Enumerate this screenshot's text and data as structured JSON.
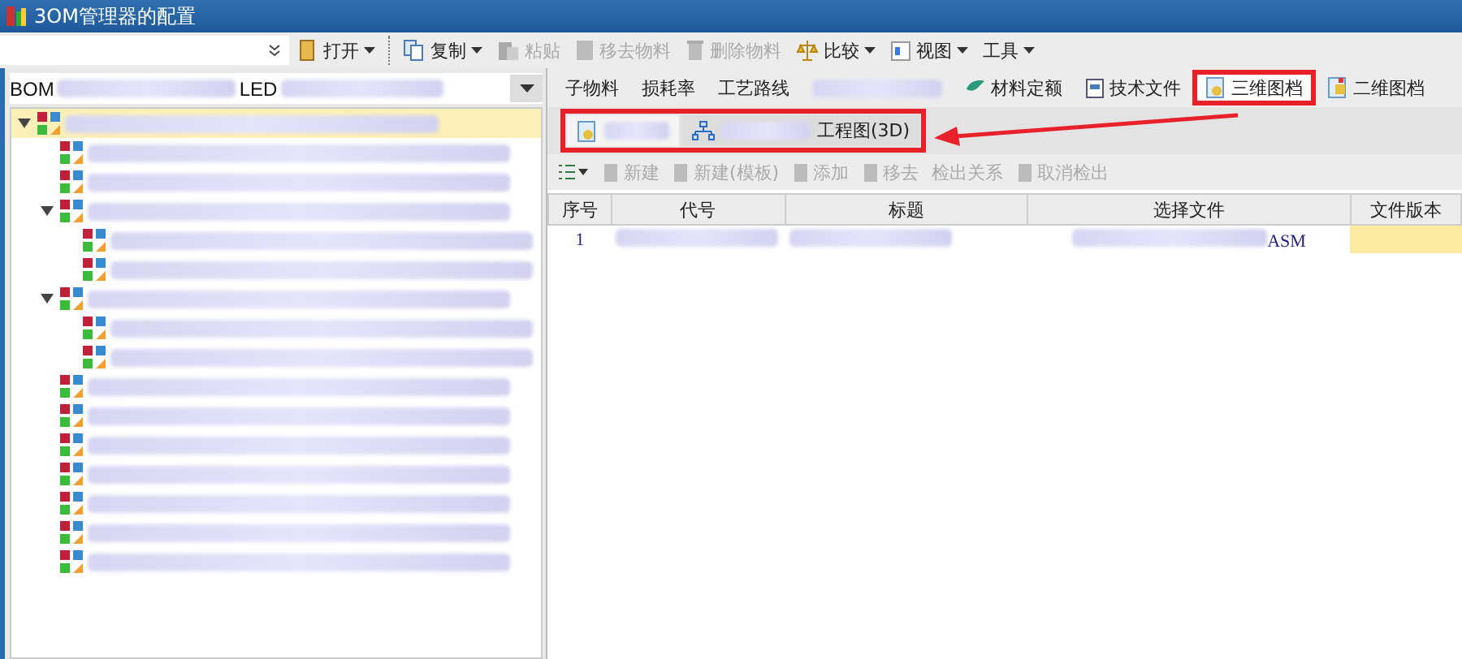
{
  "window": {
    "title": "3OM管理器的配置"
  },
  "toolbar": {
    "items": [
      {
        "label": "打开",
        "disabled": false,
        "dropdown": true
      },
      {
        "label": "复制",
        "disabled": false,
        "dropdown": true
      },
      {
        "label": "粘贴",
        "disabled": true,
        "dropdown": false
      },
      {
        "label": "移去物料",
        "disabled": true,
        "dropdown": false
      },
      {
        "label": "删除物料",
        "disabled": true,
        "dropdown": false
      },
      {
        "label": "比较",
        "disabled": false,
        "dropdown": true
      },
      {
        "label": "视图",
        "disabled": false,
        "dropdown": true
      },
      {
        "label": "工具",
        "disabled": false,
        "dropdown": true
      }
    ]
  },
  "bom_selector": {
    "prefix": "BOM",
    "middle": "LED"
  },
  "tree": {
    "items": [
      {
        "selected": true,
        "expanded": true,
        "children": [
          {
            "selected": false
          },
          {
            "selected": false
          },
          {
            "selected": false,
            "expanded": true,
            "children": [
              {
                "selected": false
              },
              {
                "selected": false
              }
            ]
          },
          {
            "selected": false,
            "expanded": true,
            "children": [
              {
                "selected": false
              },
              {
                "selected": false
              }
            ]
          },
          {
            "selected": false
          },
          {
            "selected": false
          },
          {
            "selected": false
          },
          {
            "selected": false
          },
          {
            "selected": false
          },
          {
            "selected": false
          },
          {
            "selected": false
          }
        ]
      }
    ]
  },
  "tabs": [
    {
      "label": "子物料",
      "selected": false,
      "highlighted": false
    },
    {
      "label": "损耗率",
      "selected": false,
      "highlighted": false
    },
    {
      "label": "工艺路线",
      "selected": false,
      "highlighted": false
    },
    {
      "selected": false,
      "highlighted": false
    },
    {
      "label": "材料定额",
      "selected": false,
      "highlighted": false
    },
    {
      "label": "技术文件",
      "selected": false,
      "highlighted": false
    },
    {
      "label": "三维图档",
      "selected": true,
      "highlighted": true
    },
    {
      "label": "二维图档",
      "selected": false,
      "highlighted": false
    }
  ],
  "subtabs": {
    "highlighted": true,
    "items": [
      {
        "selected": true
      },
      {
        "label": "工程图(3D)",
        "selected": false
      }
    ]
  },
  "annotation_arrow": true,
  "actions": [
    {
      "label": "新建",
      "disabled": true
    },
    {
      "label": "新建(模板)",
      "disabled": true
    },
    {
      "label": "添加",
      "disabled": true
    },
    {
      "label": "移去",
      "disabled": true
    },
    {
      "label": "检出关系",
      "disabled": true
    },
    {
      "label": "取消检出",
      "disabled": true
    }
  ],
  "table": {
    "columns": [
      "序号",
      "代号",
      "标题",
      "选择文件",
      "文件版本"
    ],
    "rows": [
      {
        "cells": [
          "1",
          "",
          "",
          "ASM",
          ""
        ]
      }
    ]
  }
}
